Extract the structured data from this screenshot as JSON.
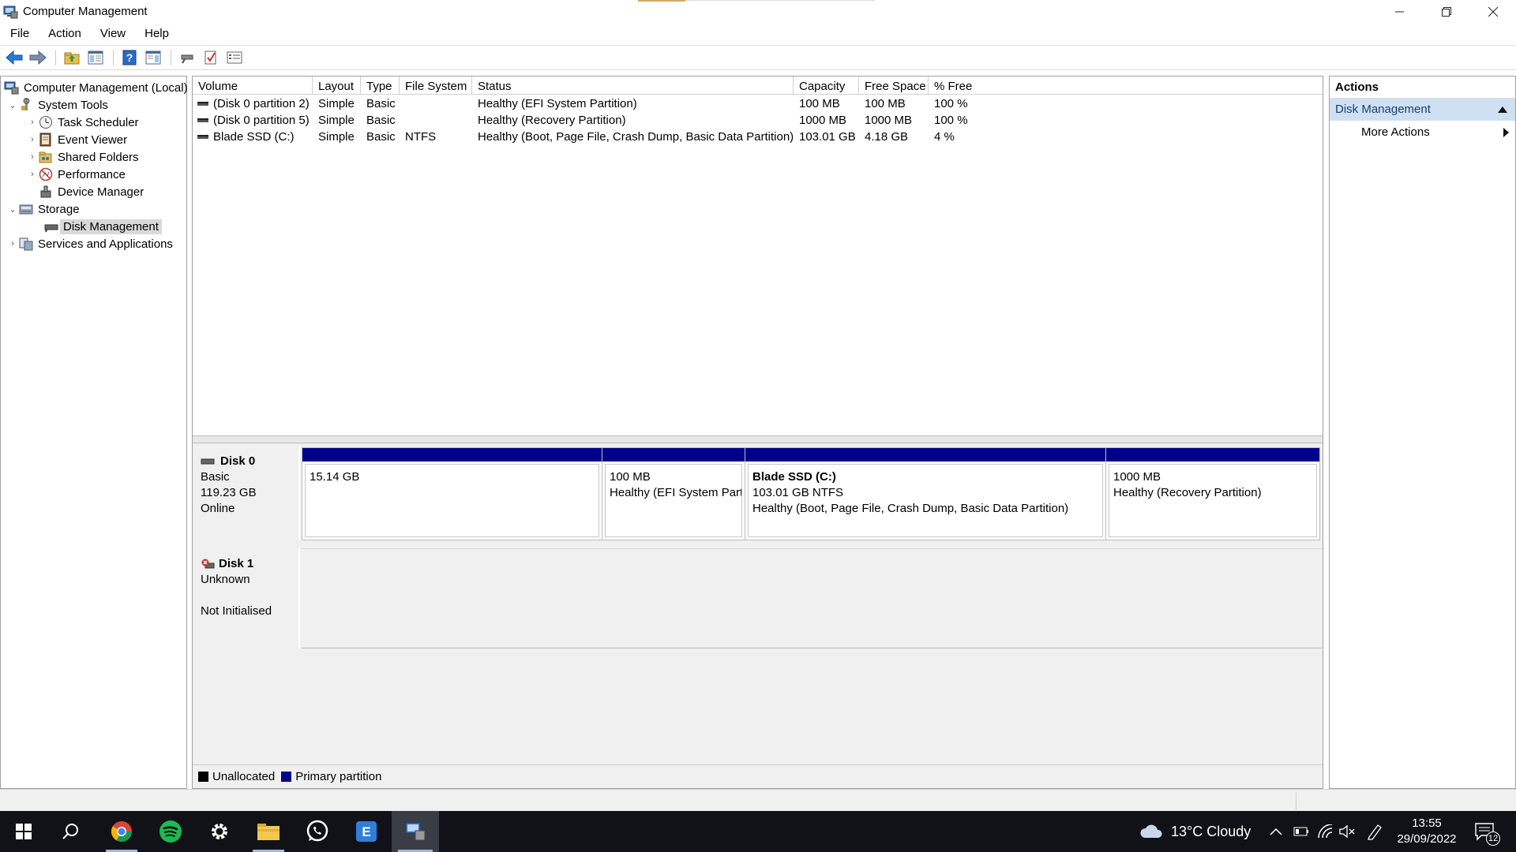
{
  "window": {
    "title": "Computer Management"
  },
  "menu": [
    "File",
    "Action",
    "View",
    "Help"
  ],
  "tree": {
    "root": "Computer Management (Local)",
    "system_tools": "System Tools",
    "task_scheduler": "Task Scheduler",
    "event_viewer": "Event Viewer",
    "shared_folders": "Shared Folders",
    "performance": "Performance",
    "device_manager": "Device Manager",
    "storage": "Storage",
    "disk_management": "Disk Management",
    "services": "Services and Applications"
  },
  "volumes": {
    "columns": [
      "Volume",
      "Layout",
      "Type",
      "File System",
      "Status",
      "Capacity",
      "Free Space",
      "% Free"
    ],
    "rows": [
      [
        "(Disk 0 partition 2)",
        "Simple",
        "Basic",
        "",
        "Healthy (EFI System Partition)",
        "100 MB",
        "100 MB",
        "100 %"
      ],
      [
        "(Disk 0 partition 5)",
        "Simple",
        "Basic",
        "",
        "Healthy (Recovery Partition)",
        "1000 MB",
        "1000 MB",
        "100 %"
      ],
      [
        "Blade SSD (C:)",
        "Simple",
        "Basic",
        "NTFS",
        "Healthy (Boot, Page File, Crash Dump, Basic Data Partition)",
        "103.01 GB",
        "4.18 GB",
        "4 %"
      ]
    ]
  },
  "disk0": {
    "name": "Disk 0",
    "type": "Basic",
    "size": "119.23 GB",
    "state": "Online",
    "partitions": [
      {
        "line1": "",
        "line2": "15.14 GB",
        "line3": ""
      },
      {
        "line1": "",
        "line2": "100 MB",
        "line3": "Healthy (EFI System Part"
      },
      {
        "line1": "Blade SSD  (C:)",
        "line2": "103.01 GB NTFS",
        "line3": "Healthy (Boot, Page File, Crash Dump, Basic Data Partition)"
      },
      {
        "line1": "",
        "line2": "1000 MB",
        "line3": "Healthy (Recovery Partition)"
      }
    ]
  },
  "disk1": {
    "name": "Disk 1",
    "type": "Unknown",
    "state": "Not Initialised"
  },
  "legend": {
    "unallocated": "Unallocated",
    "primary": "Primary partition"
  },
  "actions": {
    "title": "Actions",
    "section": "Disk Management",
    "more": "More Actions"
  },
  "taskbar": {
    "weather": "13°C  Cloudy",
    "time": "13:55",
    "date": "29/09/2022",
    "notifications": "12"
  },
  "colors": {
    "primary_partition": "#00008b",
    "unallocated": "#000000",
    "actions_header": "#cfe0f3"
  }
}
